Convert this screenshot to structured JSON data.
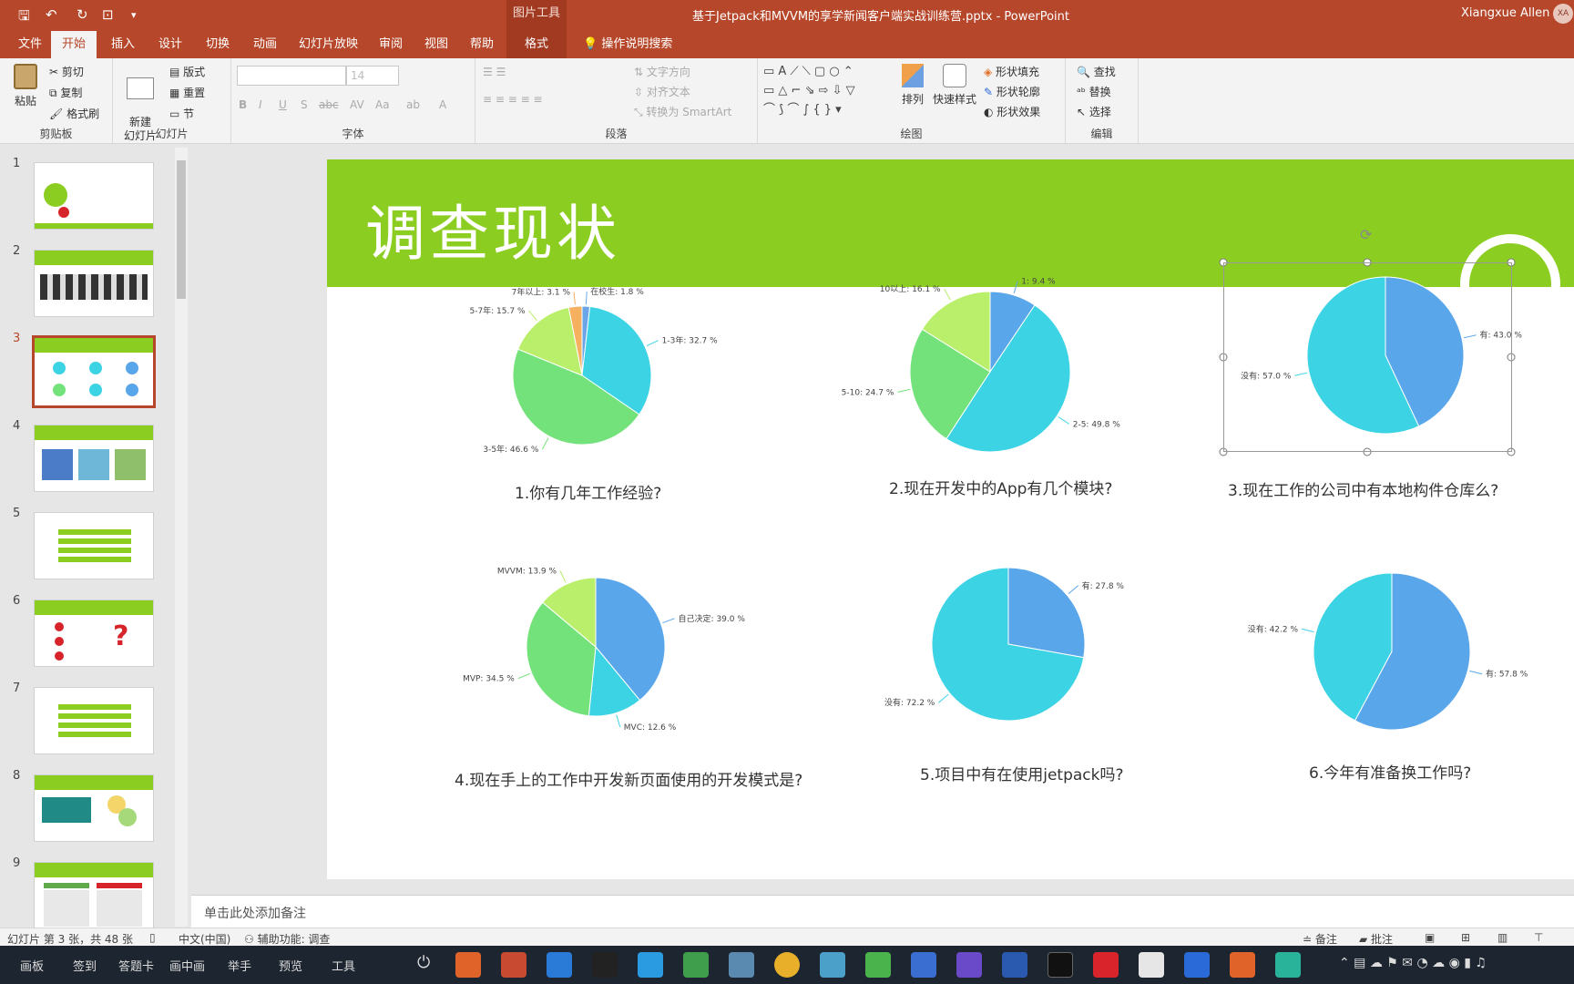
{
  "window": {
    "doc_title": "基于Jetpack和MVVM的享学新闻客户端实战训练营.pptx  -  PowerPoint",
    "context_tab_group": "图片工具",
    "user": "Xiangxue Allen",
    "avatar_initials": "XA"
  },
  "tabs": [
    "文件",
    "开始",
    "插入",
    "设计",
    "切换",
    "动画",
    "幻灯片放映",
    "审阅",
    "视图",
    "帮助",
    "格式"
  ],
  "tell_me": "操作说明搜索",
  "ribbon": {
    "clipboard": {
      "paste": "粘贴",
      "cut": "剪切",
      "copy": "复制",
      "format_painter": "格式刷",
      "label": "剪贴板"
    },
    "slides": {
      "new_slide": "新建\n幻灯片",
      "layout": "版式",
      "reset": "重置",
      "section": "节",
      "label": "幻灯片"
    },
    "font": {
      "size": "14",
      "label": "字体"
    },
    "paragraph": {
      "text_direction": "文字方向",
      "align_text": "对齐文本",
      "smartart": "转换为 SmartArt",
      "label": "段落"
    },
    "drawing": {
      "arrange": "排列",
      "quick_styles": "快速样式",
      "shape_fill": "形状填充",
      "shape_outline": "形状轮廓",
      "shape_effects": "形状效果",
      "label": "绘图"
    },
    "editing": {
      "find": "查找",
      "replace": "替换",
      "select": "选择",
      "label": "编辑"
    }
  },
  "thumbnails": [
    {
      "num": "1"
    },
    {
      "num": "2"
    },
    {
      "num": "3"
    },
    {
      "num": "4"
    },
    {
      "num": "5"
    },
    {
      "num": "6"
    },
    {
      "num": "7"
    },
    {
      "num": "8"
    },
    {
      "num": "9"
    }
  ],
  "slide": {
    "title": "调查现状"
  },
  "charts_questions": [
    "1.你有几年工作经验?",
    "2.现在开发中的App有几个模块?",
    "3.现在工作的公司中有本地构件仓库么?",
    "4.现在手上的工作中开发新页面使用的开发模式是?",
    "5.项目中有在使用jetpack吗?",
    "6.今年有准备换工作吗?"
  ],
  "chart_data": [
    {
      "type": "pie",
      "title": "1.你有几年工作经验?",
      "labels": [
        "在校生: 1.8 %",
        "1-3年: 32.7 %",
        "3-5年: 46.6 %",
        "5-7年: 15.7 %",
        "7年以上: 3.1 %"
      ],
      "values": [
        1.8,
        32.7,
        46.6,
        15.7,
        3.1
      ],
      "colors": [
        "#6aa5e8",
        "#3cd3e5",
        "#74e27a",
        "#b9ef6a",
        "#f5b060"
      ]
    },
    {
      "type": "pie",
      "title": "2.现在开发中的App有几个模块?",
      "labels": [
        "1: 9.4 %",
        "2-5: 49.8 %",
        "5-10: 24.7 %",
        "10以上: 16.1 %"
      ],
      "values": [
        9.4,
        49.8,
        24.7,
        16.1
      ],
      "colors": [
        "#5aa6ea",
        "#3cd3e5",
        "#74e27a",
        "#b9ef6a"
      ]
    },
    {
      "type": "pie",
      "title": "3.现在工作的公司中有本地构件仓库么?",
      "labels": [
        "有: 43.0 %",
        "没有: 57.0 %"
      ],
      "values": [
        43.0,
        57.0
      ],
      "colors": [
        "#5aa6ea",
        "#3cd3e5"
      ]
    },
    {
      "type": "pie",
      "title": "4.现在手上的工作中开发新页面使用的开发模式是?",
      "labels": [
        "自己决定: 39.0 %",
        "MVC: 12.6 %",
        "MVP: 34.5 %",
        "MVVM: 13.9 %"
      ],
      "values": [
        39.0,
        12.6,
        34.5,
        13.9
      ],
      "colors": [
        "#5aa6ea",
        "#3cd3e5",
        "#74e27a",
        "#b9ef6a"
      ]
    },
    {
      "type": "pie",
      "title": "5.项目中有在使用jetpack吗?",
      "labels": [
        "有: 27.8 %",
        "没有: 72.2 %"
      ],
      "values": [
        27.8,
        72.2
      ],
      "colors": [
        "#5aa6ea",
        "#3cd3e5"
      ]
    },
    {
      "type": "pie",
      "title": "6.今年有准备换工作吗?",
      "labels": [
        "有: 57.8 %",
        "没有: 42.2 %"
      ],
      "values": [
        57.8,
        42.2
      ],
      "colors": [
        "#5aa6ea",
        "#3cd3e5"
      ]
    }
  ],
  "notes_placeholder": "单击此处添加备注",
  "status": {
    "slide_info": "幻灯片 第 3 张，共 48 张",
    "language": "中文(中国)",
    "accessibility": "辅助功能: 调查",
    "notes": "备注",
    "comments": "批注"
  },
  "taskbar": {
    "items": [
      "画板",
      "签到",
      "答题卡",
      "画中画",
      "举手",
      "预览",
      "工具"
    ]
  }
}
